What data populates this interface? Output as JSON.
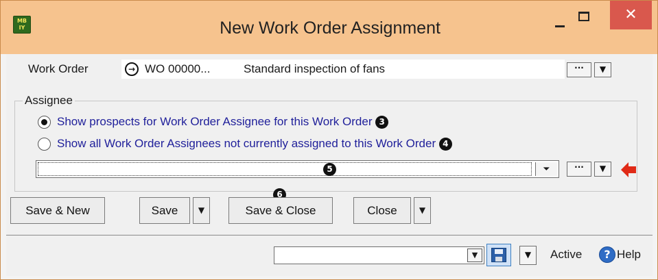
{
  "window": {
    "title": "New Work Order Assignment",
    "app_icon": {
      "text": "MB\nIY",
      "name": "mb-app-icon"
    },
    "close_glyph": "✕",
    "colors": {
      "title_bar": "#f6c38e",
      "close_button": "#d9584d",
      "radio_text": "#1f1f9a",
      "red_arrow": "#e02a17"
    }
  },
  "work_order": {
    "label": "Work Order",
    "code": "WO 00000...",
    "description": "Standard inspection of fans",
    "ellipsis": "···",
    "dropdown": "▼"
  },
  "assignee": {
    "group_title": "Assignee",
    "options": [
      {
        "text": "Show prospects for Work Order Assignee for this Work Order",
        "selected": true,
        "badge": "3"
      },
      {
        "text": "Show all Work Order Assignees not currently assigned to this Work Order",
        "selected": false,
        "badge": "4"
      }
    ],
    "combo_badge": "5",
    "combo_button": "⏷",
    "ellipsis": "···",
    "dropdown": "▼"
  },
  "buttons": {
    "save_new": "Save & New",
    "save": "Save",
    "save_close": "Save & Close",
    "save_close_badge": "6",
    "close": "Close",
    "dropdown": "▼"
  },
  "status": {
    "active": "Active",
    "help": "Help",
    "help_glyph": "?",
    "dropdown": "▼"
  }
}
